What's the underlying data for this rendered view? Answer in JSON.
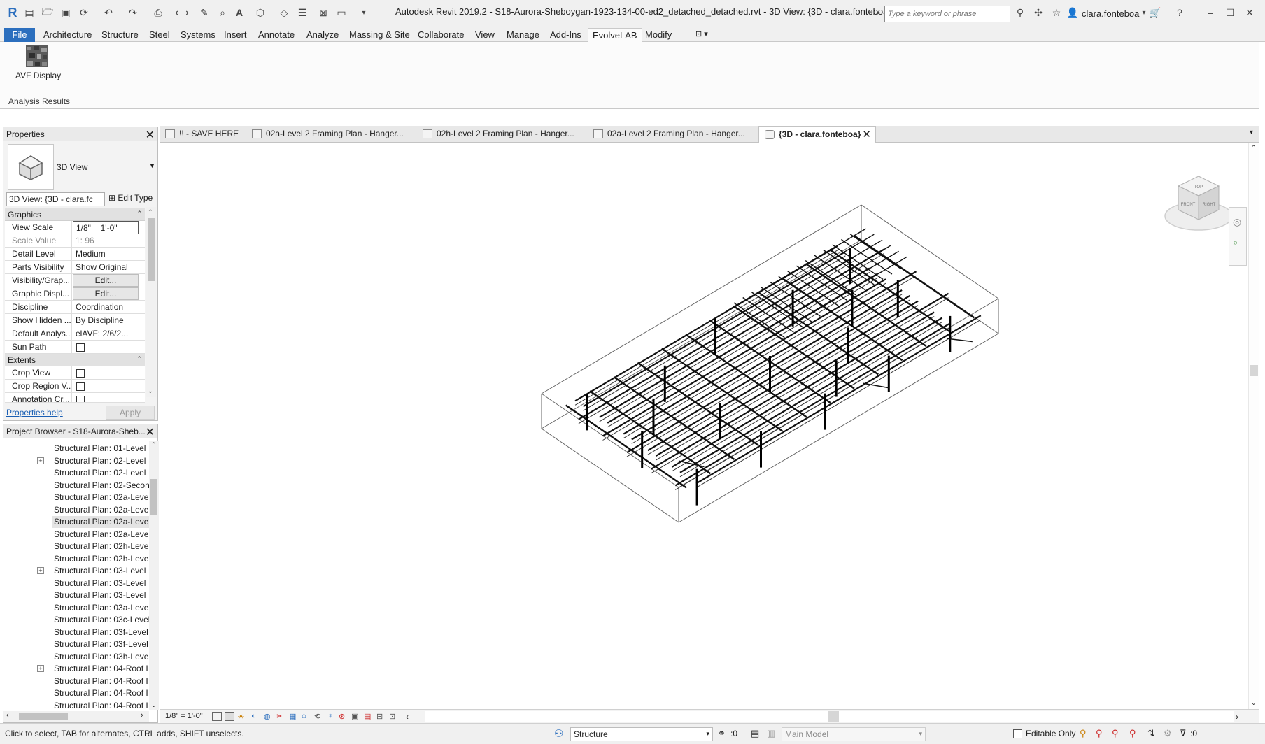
{
  "app": {
    "title": "Autodesk Revit 2019.2 - S18-Aurora-Sheboygan-1923-134-00-ed2_detached_detached.rvt - 3D View: {3D - clara.fonteboa}",
    "search_placeholder": "Type a keyword or phrase",
    "user": "clara.fonteboa"
  },
  "ribbon": {
    "tabs": [
      "File",
      "Architecture",
      "Structure",
      "Steel",
      "Systems",
      "Insert",
      "Annotate",
      "Analyze",
      "Massing & Site",
      "Collaborate",
      "View",
      "Manage",
      "Add-Ins",
      "EvolveLAB",
      "Modify"
    ],
    "active_tab": "EvolveLAB",
    "button_label": "AVF Display",
    "panel_label": "Analysis Results"
  },
  "properties": {
    "title": "Properties",
    "type_name": "3D View",
    "view_selector": "3D View: {3D - clara.fc",
    "edit_type": "Edit Type",
    "group_graphics": "Graphics",
    "group_extents": "Extents",
    "rows": [
      {
        "key": "View Scale",
        "value": "1/8\" = 1'-0\""
      },
      {
        "key": "Scale Value",
        "value": "1:  96"
      },
      {
        "key": "Detail Level",
        "value": "Medium"
      },
      {
        "key": "Parts Visibility",
        "value": "Show Original"
      },
      {
        "key": "Visibility/Grap...",
        "value": "Edit..."
      },
      {
        "key": "Graphic Displ...",
        "value": "Edit..."
      },
      {
        "key": "Discipline",
        "value": "Coordination"
      },
      {
        "key": "Show Hidden ...",
        "value": "By Discipline"
      },
      {
        "key": "Default Analys...",
        "value": "elAVF: 2/6/2..."
      },
      {
        "key": "Sun Path",
        "value": ""
      }
    ],
    "extents_rows": [
      {
        "key": "Crop View",
        "value": ""
      },
      {
        "key": "Crop Region V...",
        "value": ""
      },
      {
        "key": "Annotation Cr...",
        "value": ""
      }
    ],
    "help_link": "Properties help",
    "apply": "Apply"
  },
  "browser": {
    "title": "Project Browser - S18-Aurora-Sheb...",
    "items": [
      "Structural Plan: 01-Level",
      "Structural Plan: 02-Level",
      "Structural Plan: 02-Level",
      "Structural Plan: 02-Secon",
      "Structural Plan: 02a-Leve",
      "Structural Plan: 02a-Leve",
      "Structural Plan: 02a-Leve",
      "Structural Plan: 02a-Leve",
      "Structural Plan: 02h-Leve",
      "Structural Plan: 02h-Leve",
      "Structural Plan: 03-Level",
      "Structural Plan: 03-Level",
      "Structural Plan: 03-Level",
      "Structural Plan: 03a-Leve",
      "Structural Plan: 03c-Level",
      "Structural Plan: 03f-Level",
      "Structural Plan: 03f-Level",
      "Structural Plan: 03h-Leve",
      "Structural Plan: 04-Roof I",
      "Structural Plan: 04-Roof I",
      "Structural Plan: 04-Roof I",
      "Structural Plan: 04-Roof I"
    ],
    "selected_index": 6
  },
  "view_tabs": [
    "!! - SAVE HERE",
    "02a-Level 2 Framing Plan - Hanger...",
    "02h-Level 2 Framing Plan - Hanger...",
    "02a-Level 2 Framing Plan - Hanger...",
    "{3D - clara.fonteboa}"
  ],
  "view_control": {
    "scale": "1/8\" = 1'-0\""
  },
  "status": {
    "hint": "Click to select, TAB for alternates, CTRL adds, SHIFT unselects.",
    "workset": "Structure",
    "count1": ":0",
    "design_option": "Main Model",
    "editable_only": "Editable Only",
    "count2": ":0"
  },
  "viewcube": {
    "top": "TOP",
    "front": "FRONT",
    "right": "RIGHT"
  },
  "colors": {
    "file_tab": "#2c6fbe",
    "link": "#1a5fb4"
  }
}
